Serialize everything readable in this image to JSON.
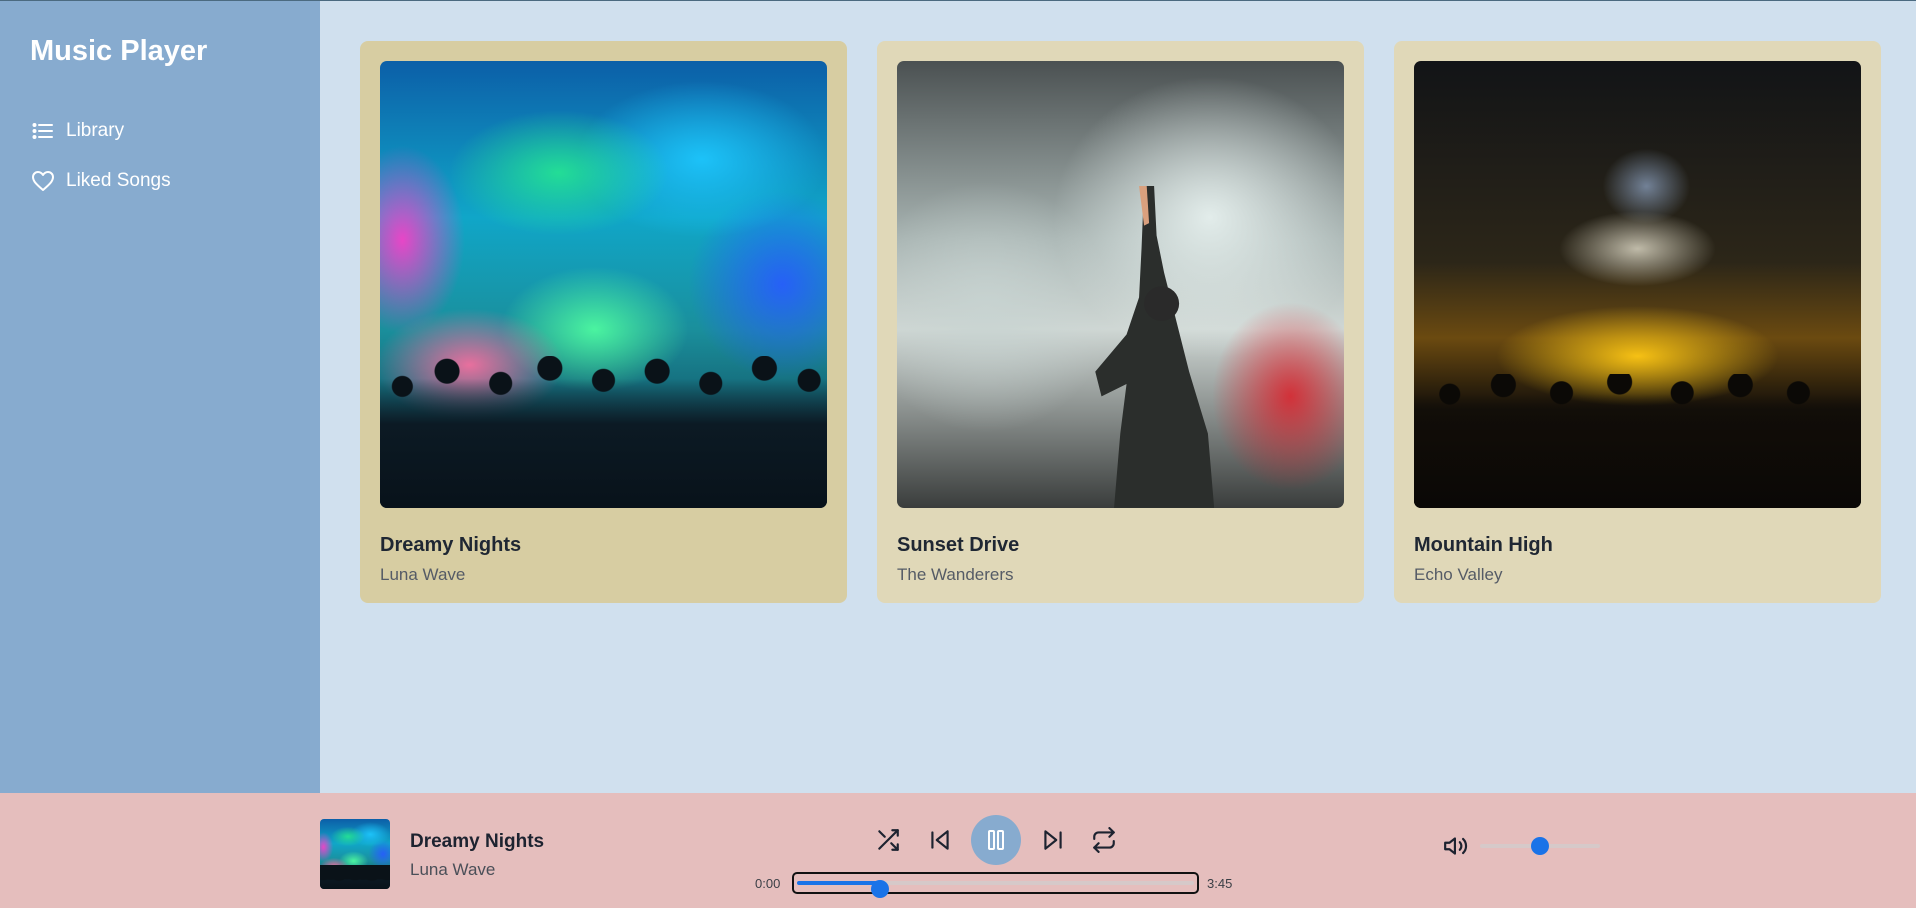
{
  "app": {
    "title": "Music Player"
  },
  "sidebar": {
    "items": [
      {
        "label": "Library",
        "icon": "list-icon"
      },
      {
        "label": "Liked Songs",
        "icon": "heart-icon"
      }
    ]
  },
  "albums": [
    {
      "title": "Dreamy Nights",
      "artist": "Luna Wave",
      "active": true
    },
    {
      "title": "Sunset Drive",
      "artist": "The Wanderers",
      "active": false
    },
    {
      "title": "Mountain High",
      "artist": "Echo Valley",
      "active": false
    }
  ],
  "player": {
    "title": "Dreamy Nights",
    "artist": "Luna Wave",
    "current_time": "0:00",
    "total_time": "3:45",
    "progress": 0.21,
    "volume": 0.5,
    "state": "playing",
    "controls": [
      "shuffle-icon",
      "previous-icon",
      "pause-icon",
      "next-icon",
      "repeat-icon"
    ]
  },
  "colors": {
    "sidebar": "#87abcf",
    "main_bg": "#d0e0ee",
    "card_bg": "#e0d8b8",
    "card_active_bg": "#d7cda2",
    "player_bg": "#e5bebd",
    "accent": "#1a73e8"
  }
}
